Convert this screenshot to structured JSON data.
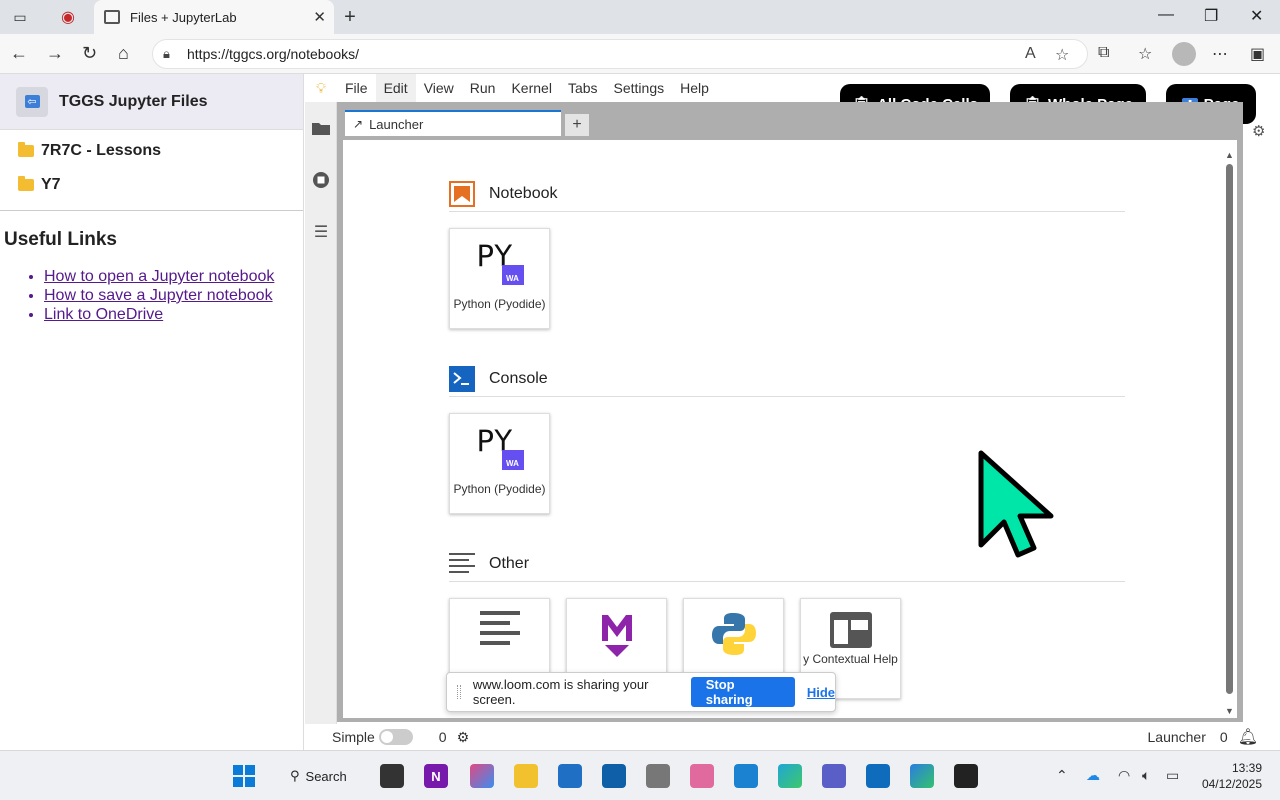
{
  "browser": {
    "tab_title": "Files + JupyterLab",
    "url": "https://tggcs.org/notebooks/"
  },
  "left_panel": {
    "title": "TGGS Jupyter Files",
    "folders": [
      {
        "name": "7R7C - Lessons"
      },
      {
        "name": "Y7"
      }
    ],
    "links_heading": "Useful Links",
    "links": [
      {
        "text": "How to open a Jupyter notebook"
      },
      {
        "text": "How to save a Jupyter notebook"
      },
      {
        "text": "Link to OneDrive"
      }
    ]
  },
  "menubar": {
    "items": [
      "File",
      "Edit",
      "View",
      "Run",
      "Kernel",
      "Tabs",
      "Settings",
      "Help"
    ]
  },
  "float_buttons": {
    "all_code_cells": "All Code Cells",
    "whole_page": "Whole Page",
    "page": "Page"
  },
  "launcher": {
    "tab_label": "Launcher",
    "sections": [
      {
        "title": "Notebook",
        "kernel": "Python (Pyodide)"
      },
      {
        "title": "Console",
        "kernel": "Python (Pyodide)"
      },
      {
        "title": "Other",
        "partial_label": "Contextual Help",
        "partial_prefix": "y"
      }
    ],
    "py_logo_text": "PY",
    "wa_text": "WA"
  },
  "screen_share": {
    "message": "www.loom.com is sharing your screen.",
    "stop_label": "Stop sharing",
    "hide_label": "Hide"
  },
  "statusbar": {
    "mode_label": "Simple",
    "count_left": "0",
    "right_label": "Launcher",
    "count_right": "0"
  },
  "taskbar": {
    "search_label": "Search",
    "time": "13:39",
    "date": "04/12/2025"
  },
  "colors": {
    "accent": "#1976d2",
    "cursor_fill": "#00e6a8",
    "stop_button": "#1a73e8"
  }
}
